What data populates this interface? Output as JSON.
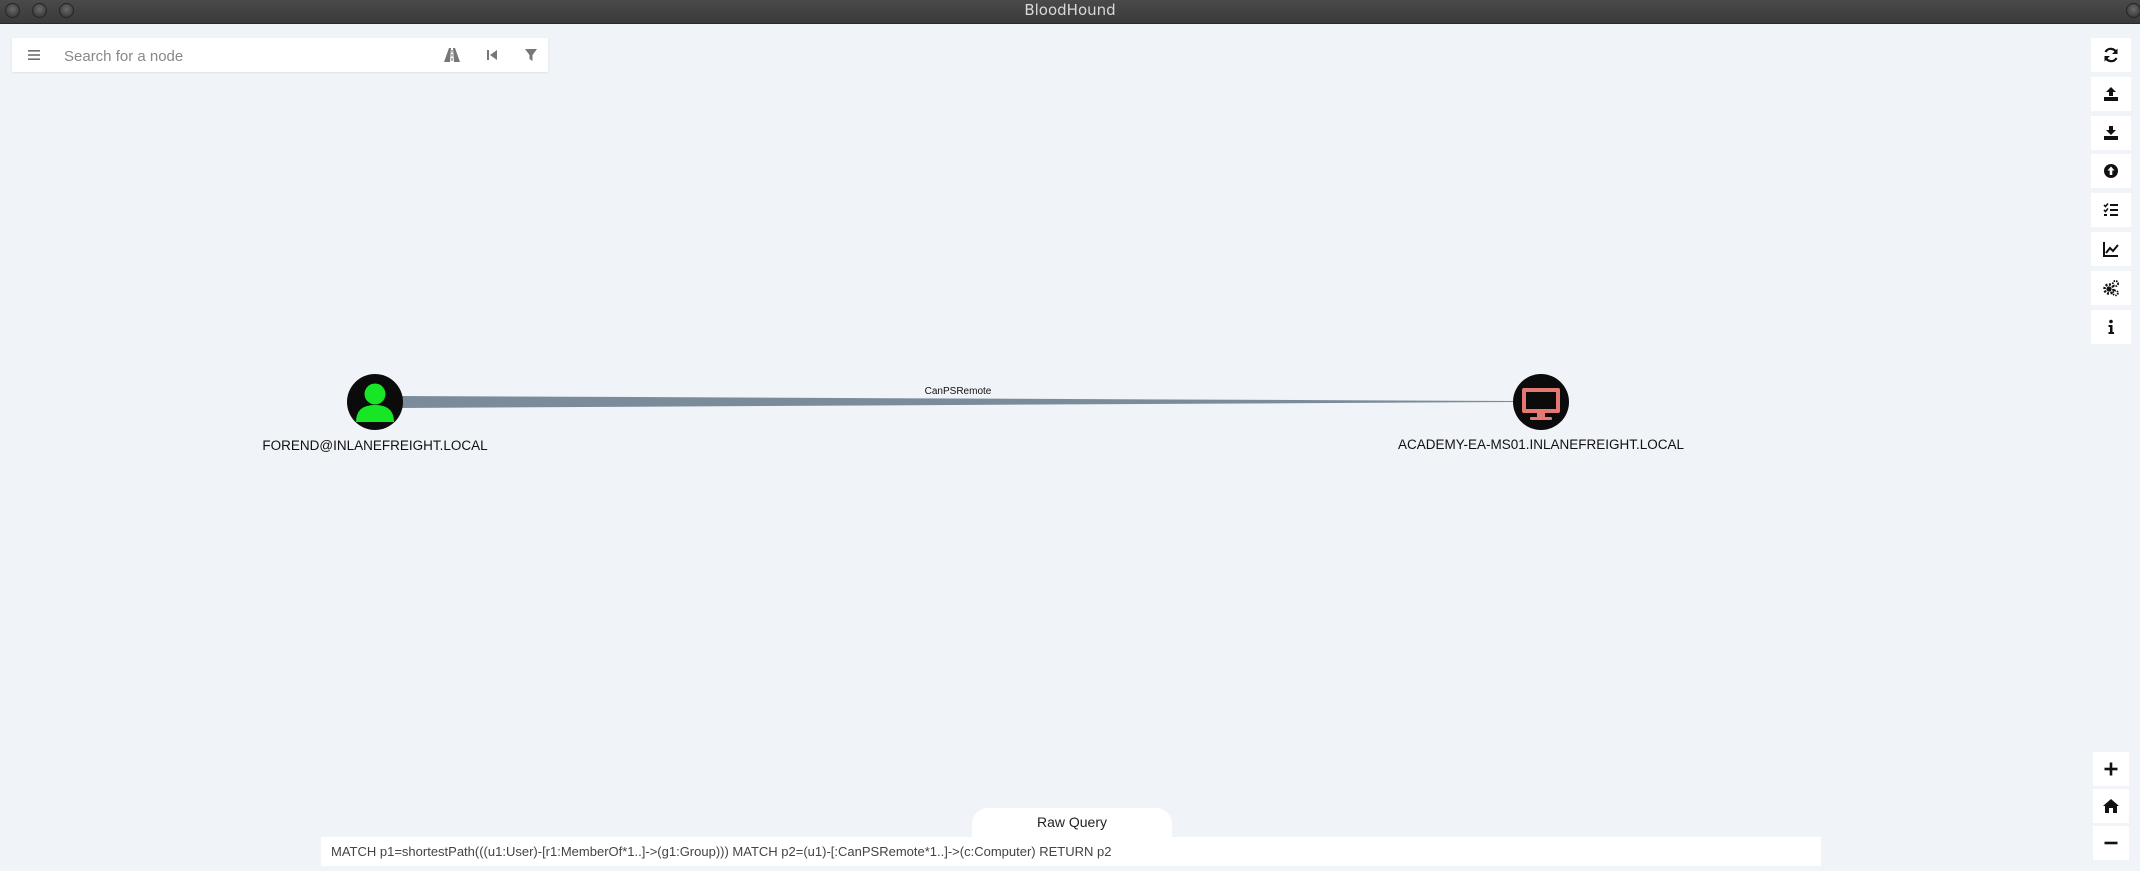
{
  "window": {
    "title": "BloodHound"
  },
  "search": {
    "placeholder": "Search for a node",
    "value": ""
  },
  "icons": {
    "menu": "hamburger-icon",
    "pathfinding": "road-icon",
    "back": "step-backward-icon",
    "filter": "filter-icon"
  },
  "toolbar": [
    {
      "name": "refresh-icon"
    },
    {
      "name": "upload-icon"
    },
    {
      "name": "download-icon"
    },
    {
      "name": "upload-data-icon"
    },
    {
      "name": "tasks-list-icon"
    },
    {
      "name": "chart-icon"
    },
    {
      "name": "settings-cogs-icon"
    },
    {
      "name": "info-icon"
    }
  ],
  "zoom": [
    {
      "name": "zoom-in-icon"
    },
    {
      "name": "home-icon"
    },
    {
      "name": "zoom-out-icon"
    }
  ],
  "graph": {
    "nodes": [
      {
        "type": "User",
        "label": "FOREND@INLANEFREIGHT.LOCAL",
        "icon": "user-icon",
        "color": "#17e625"
      },
      {
        "type": "Computer",
        "label": "ACADEMY-EA-MS01.INLANEFREIGHT.LOCAL",
        "icon": "desktop-icon",
        "color": "#e67873"
      }
    ],
    "edges": [
      {
        "label": "CanPSRemote",
        "from": "FOREND@INLANEFREIGHT.LOCAL",
        "to": "ACADEMY-EA-MS01.INLANEFREIGHT.LOCAL",
        "color": "#7a8c99"
      }
    ]
  },
  "raw_query": {
    "tab_label": "Raw Query",
    "value": "MATCH p1=shortestPath(((u1:User)-[r1:MemberOf*1..]->(g1:Group))) MATCH p2=(u1)-[:CanPSRemote*1..]->(c:Computer) RETURN p2"
  }
}
